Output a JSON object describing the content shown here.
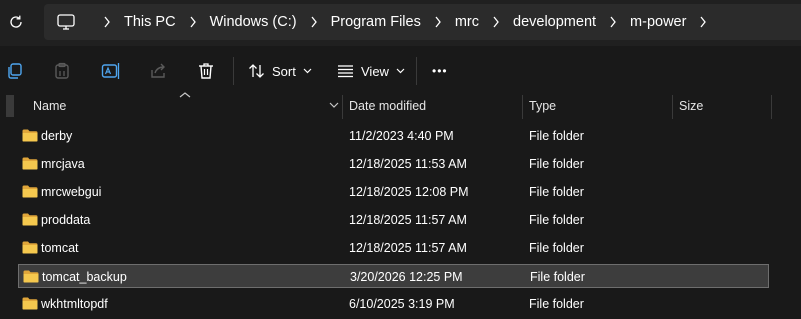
{
  "window": {
    "accent_color": "#0078d4",
    "folder_color": "#f3c14b"
  },
  "address_bar": {
    "refresh_icon": "refresh-icon",
    "root_icon": "this-pc-icon",
    "crumbs": [
      "This PC",
      "Windows (C:)",
      "Program Files",
      "mrc",
      "development",
      "m-power"
    ]
  },
  "toolbar": {
    "buttons": [
      {
        "name": "copy",
        "icon": "copy-icon"
      },
      {
        "name": "paste",
        "icon": "paste-icon"
      },
      {
        "name": "rename",
        "icon": "rename-icon"
      },
      {
        "name": "share",
        "icon": "share-icon"
      },
      {
        "name": "delete",
        "icon": "trash-icon"
      }
    ],
    "sort_label": "Sort",
    "view_label": "View",
    "more_label": "•••"
  },
  "columns": {
    "name": "Name",
    "date": "Date modified",
    "type": "Type",
    "size": "Size"
  },
  "files": [
    {
      "name": "derby",
      "date": "11/2/2023 4:40 PM",
      "type": "File folder",
      "size": ""
    },
    {
      "name": "mrcjava",
      "date": "12/18/2025 11:53 AM",
      "type": "File folder",
      "size": ""
    },
    {
      "name": "mrcwebgui",
      "date": "12/18/2025 12:08 PM",
      "type": "File folder",
      "size": ""
    },
    {
      "name": "proddata",
      "date": "12/18/2025 11:57 AM",
      "type": "File folder",
      "size": ""
    },
    {
      "name": "tomcat",
      "date": "12/18/2025 11:57 AM",
      "type": "File folder",
      "size": ""
    },
    {
      "name": "tomcat_backup",
      "date": "3/20/2026 12:25 PM",
      "type": "File folder",
      "size": "",
      "selected": true
    },
    {
      "name": "wkhtmltopdf",
      "date": "6/10/2025 3:19 PM",
      "type": "File folder",
      "size": ""
    }
  ]
}
